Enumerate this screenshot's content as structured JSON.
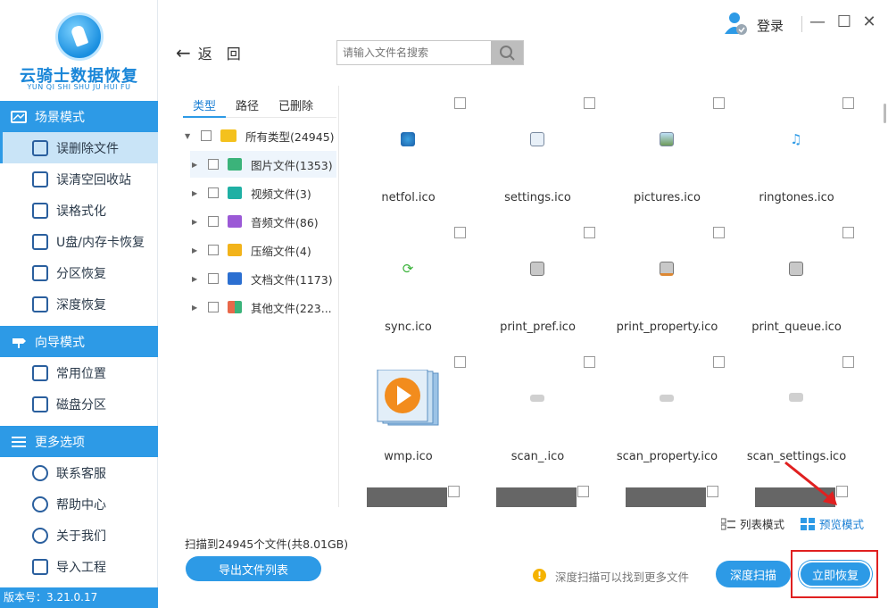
{
  "app": {
    "title": "云骑士数据恢复",
    "subtitle": "YUN QI SHI SHU JU HUI FU",
    "version": "版本号：3.21.0.17"
  },
  "window": {
    "login": "登录",
    "minimize": "—",
    "maximize": "☐",
    "close": "✕"
  },
  "sidebar": {
    "sections": [
      {
        "title": "场景模式",
        "items": [
          "误删除文件",
          "误清空回收站",
          "误格式化",
          "U盘/内存卡恢复",
          "分区恢复",
          "深度恢复"
        ]
      },
      {
        "title": "向导模式",
        "items": [
          "常用位置",
          "磁盘分区"
        ]
      },
      {
        "title": "更多选项",
        "items": [
          "联系客服",
          "帮助中心",
          "关于我们",
          "导入工程"
        ]
      }
    ]
  },
  "toolbar": {
    "back_label": "返　回",
    "search_placeholder": "请输入文件名搜索"
  },
  "tree": {
    "tabs": [
      "类型",
      "路径",
      "已删除"
    ],
    "rows": [
      {
        "label": "所有类型(24945)",
        "color": "#f4c11d"
      },
      {
        "label": "图片文件(1353)",
        "color": "#3bb37a"
      },
      {
        "label": "视频文件(3)",
        "color": "#1fb0a4"
      },
      {
        "label": "音频文件(86)",
        "color": "#9b59d6"
      },
      {
        "label": "压缩文件(4)",
        "color": "#f2b31a"
      },
      {
        "label": "文档文件(1173)",
        "color": "#2b6fd1"
      },
      {
        "label": "其他文件(223...",
        "color": "#e8684a"
      }
    ]
  },
  "files": [
    "netfol.ico",
    "settings.ico",
    "pictures.ico",
    "ringtones.ico",
    "sync.ico",
    "print_pref.ico",
    "print_property.ico",
    "print_queue.ico",
    "wmp.ico",
    "scan_.ico",
    "scan_property.ico",
    "scan_settings.ico"
  ],
  "view": {
    "list_mode": "列表模式",
    "preview_mode": "预览模式"
  },
  "footer": {
    "scan_info": "扫描到24945个文件(共8.01GB)",
    "export_label": "导出文件列表",
    "tip": "深度扫描可以找到更多文件",
    "deep_scan_label": "深度扫描",
    "recover_label": "立即恢复"
  },
  "colors": {
    "accent": "#2d9ae6",
    "highlight": "#e02020"
  }
}
